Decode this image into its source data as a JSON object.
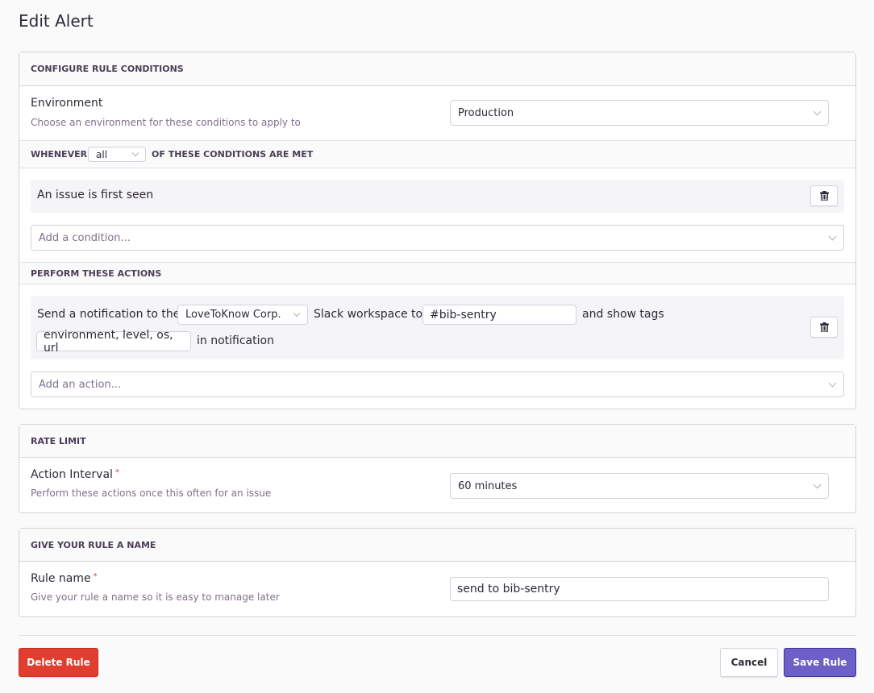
{
  "page": {
    "title": "Edit Alert"
  },
  "conditions_panel": {
    "header": "CONFIGURE RULE CONDITIONS",
    "environment": {
      "label": "Environment",
      "help": "Choose an environment for these conditions to apply to",
      "value": "Production"
    },
    "whenever": {
      "prefix": "WHENEVER",
      "match_value": "all",
      "suffix": "OF THESE CONDITIONS ARE MET"
    },
    "conditions": [
      {
        "text": "An issue is first seen"
      }
    ],
    "add_condition_placeholder": "Add a condition...",
    "actions_header": "PERFORM THESE ACTIONS",
    "action": {
      "part1": "Send a notification to the",
      "workspace": "LoveToKnow Corp.",
      "part2": "Slack workspace to",
      "channel": "#bib-sentry",
      "part3": "and show tags",
      "tags": "environment, level, os, url",
      "part4": "in notification"
    },
    "add_action_placeholder": "Add an action..."
  },
  "rate_limit_panel": {
    "header": "RATE LIMIT",
    "label": "Action Interval",
    "required_mark": "*",
    "help": "Perform these actions once this often for an issue",
    "value": "60 minutes"
  },
  "name_panel": {
    "header": "GIVE YOUR RULE A NAME",
    "label": "Rule name",
    "required_mark": "*",
    "help": "Give your rule a name so it is easy to manage later",
    "value": "send to bib-sentry"
  },
  "footer": {
    "delete_label": "Delete Rule",
    "cancel_label": "Cancel",
    "save_label": "Save Rule"
  },
  "colors": {
    "danger": "#e03e2f",
    "primary": "#6c5fc7",
    "border": "#d6d0dc",
    "muted_text": "#80708f"
  },
  "icons": {
    "trash": "trash-icon",
    "chevron": "chevron-down-icon"
  }
}
